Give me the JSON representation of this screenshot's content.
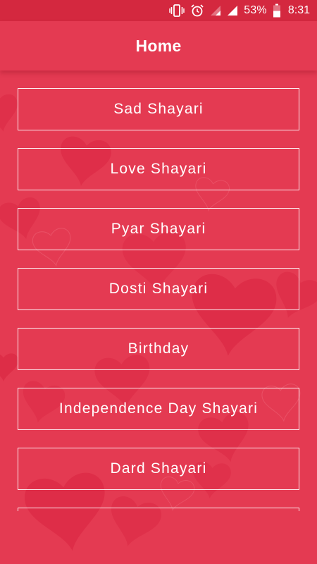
{
  "status_bar": {
    "battery_percent": "53%",
    "time": "8:31",
    "icons": [
      "vibrate-icon",
      "alarm-icon",
      "signal-empty-icon",
      "signal-icon",
      "battery-icon"
    ]
  },
  "app_bar": {
    "title": "Home"
  },
  "menu": {
    "items": [
      {
        "label": "Sad Shayari"
      },
      {
        "label": "Love Shayari"
      },
      {
        "label": "Pyar Shayari"
      },
      {
        "label": "Dosti Shayari"
      },
      {
        "label": "Birthday"
      },
      {
        "label": "Independence Day Shayari"
      },
      {
        "label": "Dard Shayari"
      },
      {
        "label": ""
      }
    ]
  },
  "colors": {
    "background": "#e43a52",
    "status_bar": "#d4283f",
    "heart_dark": "#d61f3c",
    "text": "#ffffff"
  }
}
